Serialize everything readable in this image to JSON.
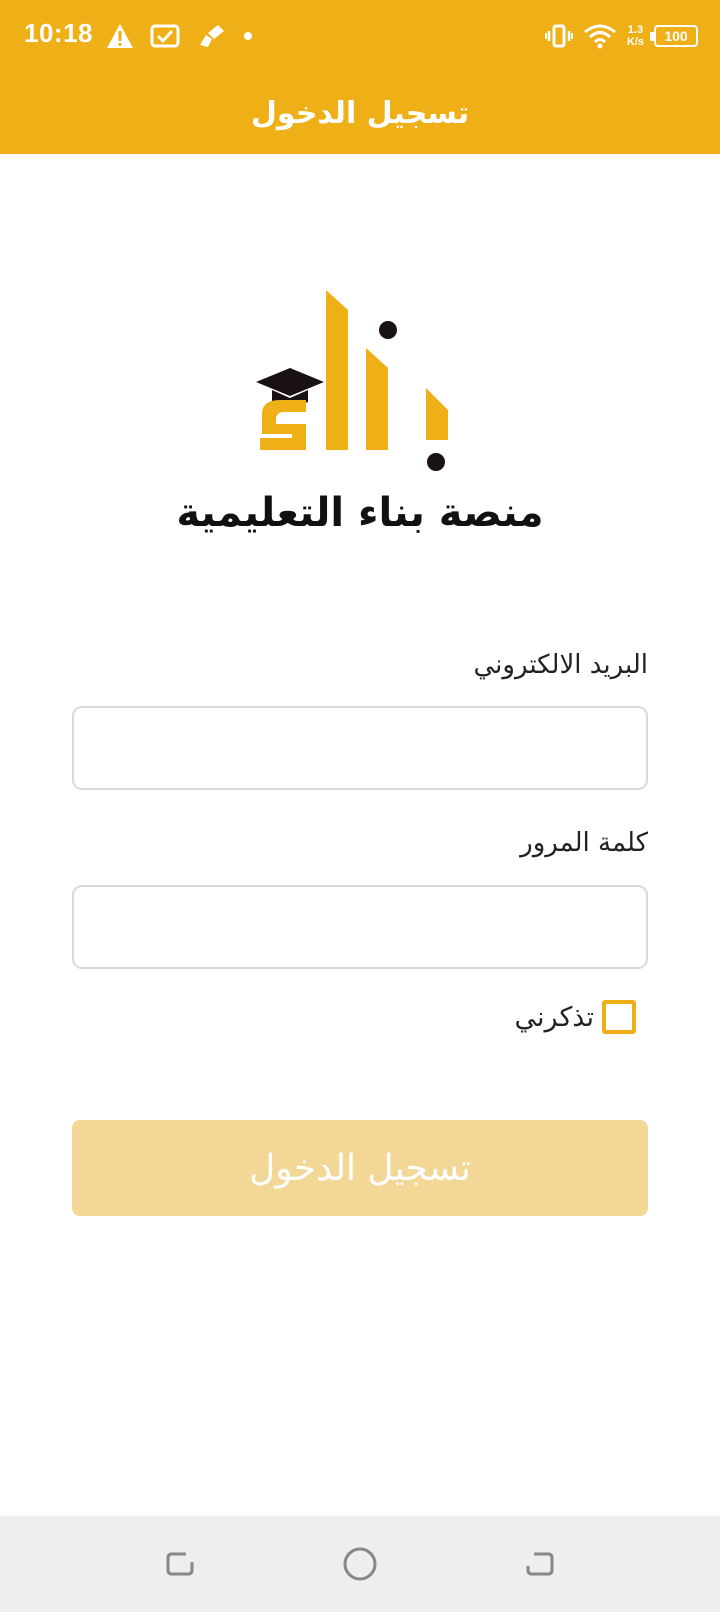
{
  "status_bar": {
    "time": "10:18",
    "network_speed_value": "1.3",
    "network_speed_unit": "K/s",
    "battery": "100",
    "icons": [
      "warning-icon",
      "checkbox-notification-icon",
      "paint-icon",
      "dot-icon",
      "vibrate-icon",
      "wifi-icon"
    ],
    "color": "#EFAF16"
  },
  "app_bar": {
    "title": "تسجيل الدخول"
  },
  "logo": {
    "brand_text": "منصة بناء التعليمية",
    "colors": {
      "gold": "#EFAF16",
      "dark": "#1A1212"
    }
  },
  "form": {
    "email": {
      "label": "البريد الالكتروني",
      "value": "",
      "placeholder": ""
    },
    "password": {
      "label": "كلمة المرور",
      "value": "",
      "placeholder": ""
    },
    "remember_me": {
      "label": "تذكرني",
      "checked": false
    },
    "submit_label": "تسجيل الدخول",
    "submit_enabled": false,
    "submit_color": "#F3D796"
  },
  "nav_bar": {
    "buttons": [
      "recent-apps-icon",
      "home-icon",
      "back-icon"
    ]
  }
}
